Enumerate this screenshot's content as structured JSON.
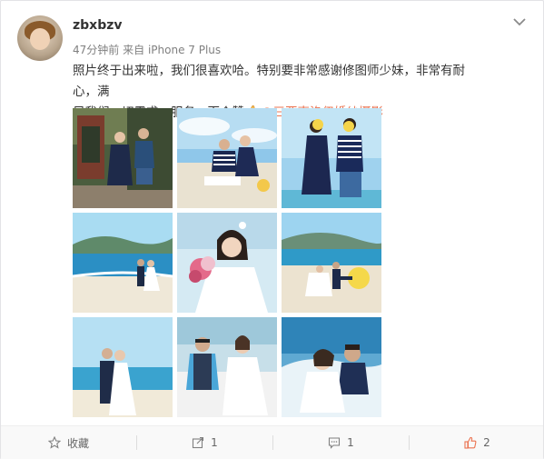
{
  "post": {
    "username": "zbxbzv",
    "time": "47分钟前",
    "source_prefix": "来自",
    "source": "iPhone 7 Plus",
    "text_line1": "照片终于出来啦，我们很喜欢哈。特别要非常感谢修图师少妹，非常有耐心，满",
    "text_line2": "足我们一切需求，服务一百个赞",
    "mention": "@三亚克洛伊婚纱摄影"
  },
  "actions": {
    "favorite_label": "收藏",
    "share_count": "1",
    "comment_count": "1",
    "like_count": "2"
  },
  "colors": {
    "mention": "#eb7350",
    "like_active": "#eb7350",
    "text": "#333333",
    "meta": "#808080"
  },
  "icons": {
    "more": "chevron-down-icon",
    "favorite": "star-icon",
    "share": "share-icon",
    "comment": "comment-icon",
    "like": "thumbs-up-icon",
    "inline_emoji": "thumbs-up-emoji"
  }
}
